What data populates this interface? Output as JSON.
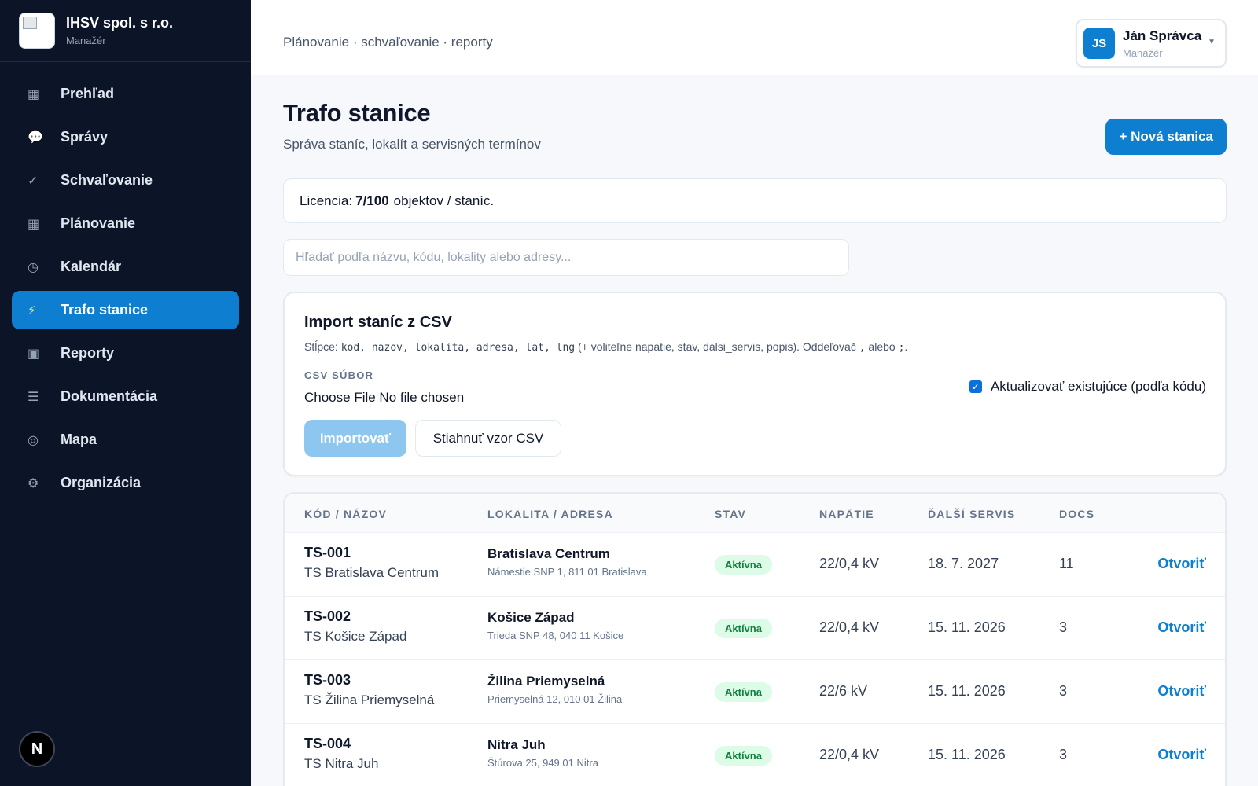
{
  "org": {
    "name": "IHSV spol. s r.o.",
    "role": "Manažér"
  },
  "nav": [
    {
      "icon": "▦",
      "label": "Prehľad"
    },
    {
      "icon": "💬",
      "label": "Správy"
    },
    {
      "icon": "✓",
      "label": "Schvaľovanie"
    },
    {
      "icon": "▦",
      "label": "Plánovanie"
    },
    {
      "icon": "◷",
      "label": "Kalendár"
    },
    {
      "icon": "⚡",
      "label": "Trafo stanice",
      "active": true
    },
    {
      "icon": "▣",
      "label": "Reporty"
    },
    {
      "icon": "☰",
      "label": "Dokumentácia"
    },
    {
      "icon": "◎",
      "label": "Mapa"
    },
    {
      "icon": "⚙",
      "label": "Organizácia"
    }
  ],
  "footer_badge": "N",
  "topbar": {
    "breadcrumb": "Plánovanie · schvaľovanie · reporty"
  },
  "user": {
    "initials": "JS",
    "name": "Ján Správca",
    "role": "Manažér"
  },
  "page": {
    "title": "Trafo stanice",
    "subtitle": "Správa staníc, lokalít a servisných termínov",
    "new_button": "+ Nová stanica"
  },
  "license": {
    "prefix": "Licencia:",
    "count": "7/100",
    "suffix": "objektov / staníc."
  },
  "search": {
    "placeholder": "Hľadať podľa názvu, kódu, lokality alebo adresy..."
  },
  "import": {
    "title": "Import staníc z CSV",
    "hint_prefix": "Stĺpce: ",
    "hint_columns": "kod, nazov, lokalita, adresa, lat, lng",
    "hint_mid": " (+ voliteľne napatie, stav, dalsi_servis, popis). Oddeľovač ",
    "hint_sep1": ",",
    "hint_or": " alebo ",
    "hint_sep2": ";",
    "hint_end": ".",
    "file_label": "CSV SÚBOR",
    "file_input": "Choose File No file chosen",
    "update_checkbox_label": "Aktualizovať existujúce (podľa kódu)",
    "update_checked": true,
    "import_button": "Importovať",
    "template_button": "Stiahnuť vzor CSV"
  },
  "table": {
    "headers": [
      "KÓD / NÁZOV",
      "LOKALITA / ADRESA",
      "STAV",
      "NAPÄTIE",
      "ĎALŠÍ SERVIS",
      "DOCS"
    ],
    "rows": [
      {
        "code": "TS-001",
        "name": "TS Bratislava Centrum",
        "location": "Bratislava Centrum",
        "address": "Námestie SNP 1, 811 01 Bratislava",
        "status": "Aktívna",
        "voltage": "22/0,4 kV",
        "next_service": "18. 7. 2027",
        "docs": "11",
        "action": "Otvoriť"
      },
      {
        "code": "TS-002",
        "name": "TS Košice Západ",
        "location": "Košice Západ",
        "address": "Trieda SNP 48, 040 11 Košice",
        "status": "Aktívna",
        "voltage": "22/0,4 kV",
        "next_service": "15. 11. 2026",
        "docs": "3",
        "action": "Otvoriť"
      },
      {
        "code": "TS-003",
        "name": "TS Žilina Priemyselná",
        "location": "Žilina Priemyselná",
        "address": "Priemyselná 12, 010 01 Žilina",
        "status": "Aktívna",
        "voltage": "22/6 kV",
        "next_service": "15. 11. 2026",
        "docs": "3",
        "action": "Otvoriť"
      },
      {
        "code": "TS-004",
        "name": "TS Nitra Juh",
        "location": "Nitra Juh",
        "address": "Štúrova 25, 949 01 Nitra",
        "status": "Aktívna",
        "voltage": "22/0,4 kV",
        "next_service": "15. 11. 2026",
        "docs": "3",
        "action": "Otvoriť"
      }
    ]
  }
}
